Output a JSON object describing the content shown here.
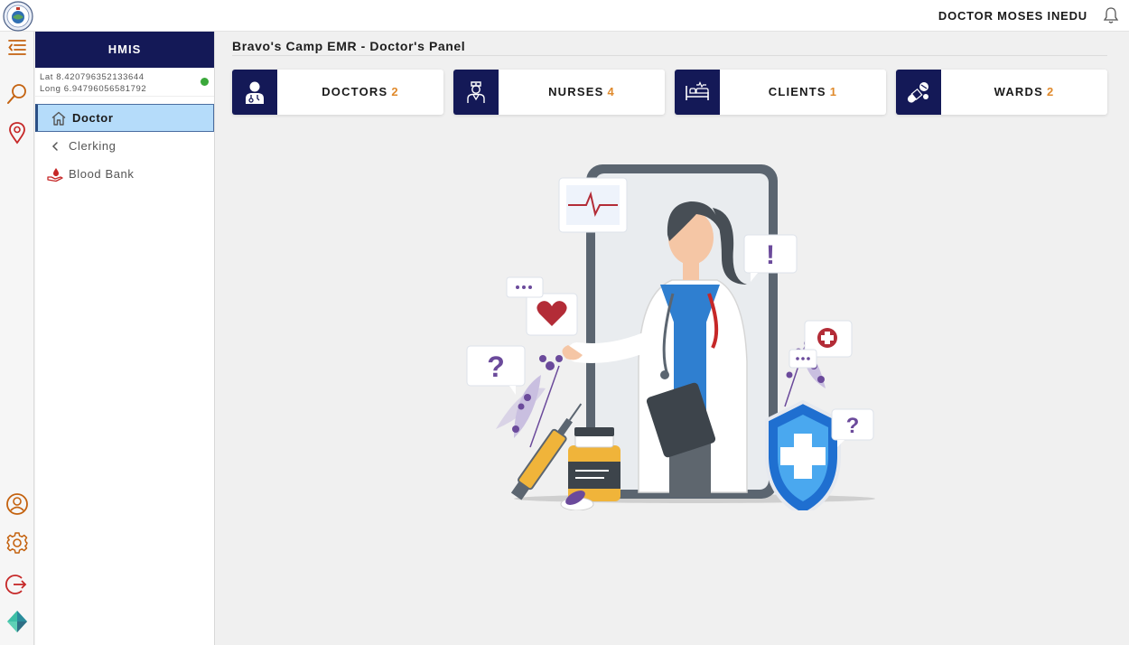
{
  "header": {
    "user_name": "DOCTOR MOSES INEDU"
  },
  "sidebar": {
    "title": "HMIS",
    "lat": "Lat 8.420796352133644",
    "long": "Long 6.94796056581792",
    "items": [
      {
        "label": "Doctor",
        "icon": "home-icon",
        "active": true
      },
      {
        "label": "Clerking",
        "icon": "chevron-left-icon",
        "active": false
      },
      {
        "label": "Blood Bank",
        "icon": "blood-bank-icon",
        "active": false
      }
    ]
  },
  "rail": {
    "icons": [
      "menu-icon",
      "search-icon",
      "location-pin-icon",
      "profile-icon",
      "settings-icon",
      "logout-icon",
      "app-logo-icon"
    ]
  },
  "main": {
    "title": "Bravo's Camp EMR - Doctor's Panel",
    "cards": [
      {
        "label": "DOCTORS",
        "count": "2",
        "icon": "doctor-icon"
      },
      {
        "label": "NURSES",
        "count": "4",
        "icon": "nurse-icon"
      },
      {
        "label": "CLIENTS",
        "count": "1",
        "icon": "bed-icon"
      },
      {
        "label": "WARDS",
        "count": "2",
        "icon": "pills-icon"
      }
    ]
  },
  "colors": {
    "navy": "#141957",
    "accent_orange": "#e08a2c",
    "active_item_bg": "#b5dcfa",
    "status_green": "#3aa83a",
    "icon_orange": "#c4620f",
    "icon_red": "#c62828"
  }
}
